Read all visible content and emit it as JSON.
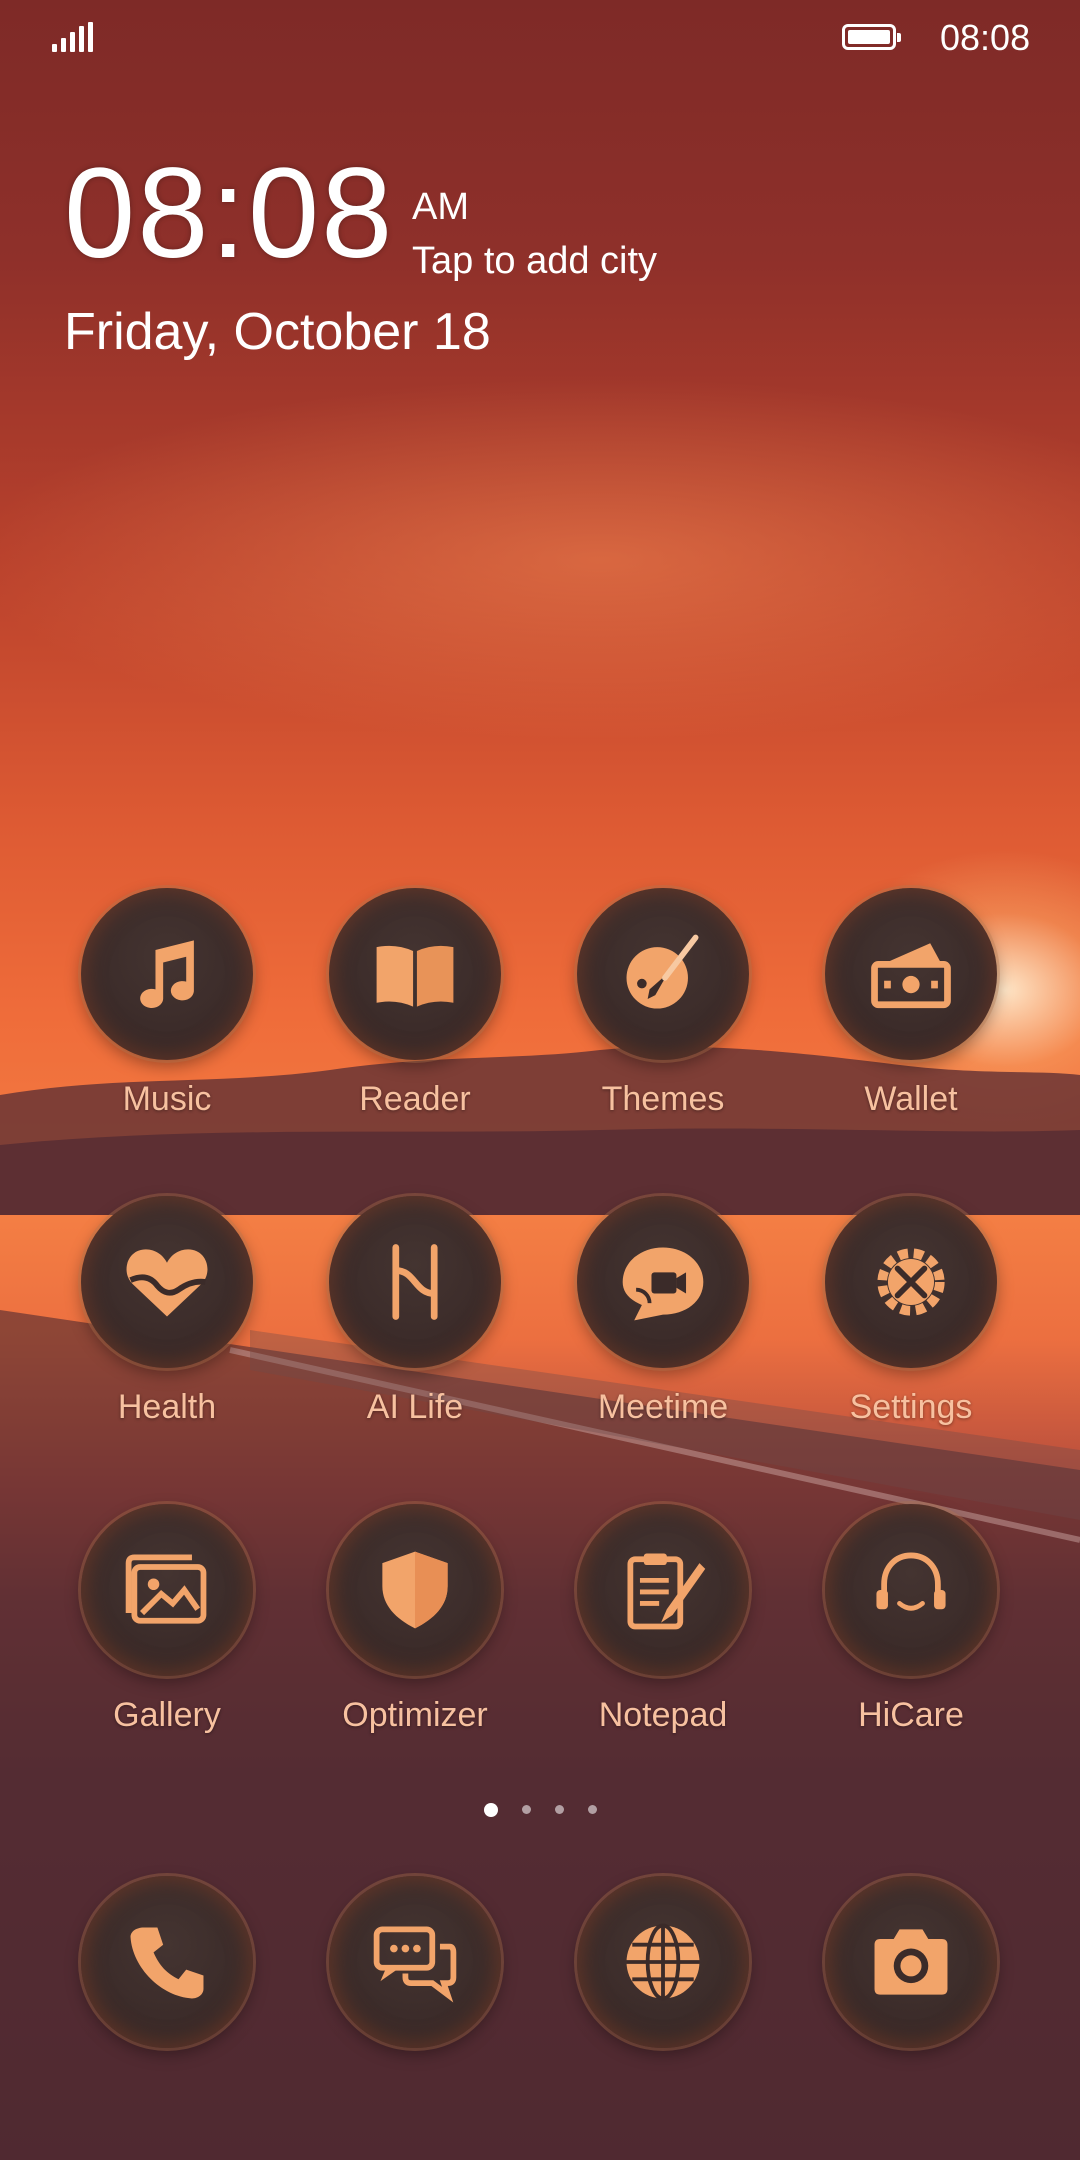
{
  "status_bar": {
    "time": "08:08",
    "signal_icon": "signal-icon",
    "battery_icon": "battery-icon"
  },
  "lock_widget": {
    "time": "08:08",
    "ampm": "AM",
    "city": "Tap to add city",
    "date": "Friday, October 18"
  },
  "apps": [
    {
      "label": "Music",
      "icon": "music-note-icon"
    },
    {
      "label": "Reader",
      "icon": "book-icon"
    },
    {
      "label": "Themes",
      "icon": "palette-brush-icon"
    },
    {
      "label": "Wallet",
      "icon": "wallet-icon"
    },
    {
      "label": "Health",
      "icon": "heart-icon"
    },
    {
      "label": "AI Life",
      "icon": "ai-life-icon"
    },
    {
      "label": "Meetime",
      "icon": "video-chat-icon"
    },
    {
      "label": "Settings",
      "icon": "gear-icon"
    },
    {
      "label": "Gallery",
      "icon": "gallery-icon"
    },
    {
      "label": "Optimizer",
      "icon": "shield-icon"
    },
    {
      "label": "Notepad",
      "icon": "notepad-icon"
    },
    {
      "label": "HiCare",
      "icon": "headset-icon"
    }
  ],
  "page_indicator": {
    "count": 4,
    "active": 0
  },
  "dock": [
    {
      "icon": "phone-icon"
    },
    {
      "icon": "messages-icon"
    },
    {
      "icon": "browser-globe-icon"
    },
    {
      "icon": "camera-icon"
    }
  ],
  "colors": {
    "icon_accent": "#f2a46a",
    "label": "#f7c1a0"
  }
}
